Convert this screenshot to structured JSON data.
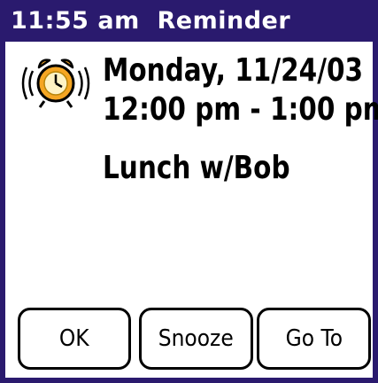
{
  "titlebar": {
    "time": "11:55 am",
    "title": "Reminder"
  },
  "event": {
    "date": "Monday, 11/24/03",
    "time_range": "12:00 pm - 1:00 pm",
    "description": "Lunch w/Bob"
  },
  "icon": "alarm-clock-ringing-icon",
  "buttons": {
    "ok": "OK",
    "snooze": "Snooze",
    "goto": "Go To"
  },
  "colors": {
    "titlebar": "#2a1a6e",
    "clock_body": "#f5a623"
  }
}
